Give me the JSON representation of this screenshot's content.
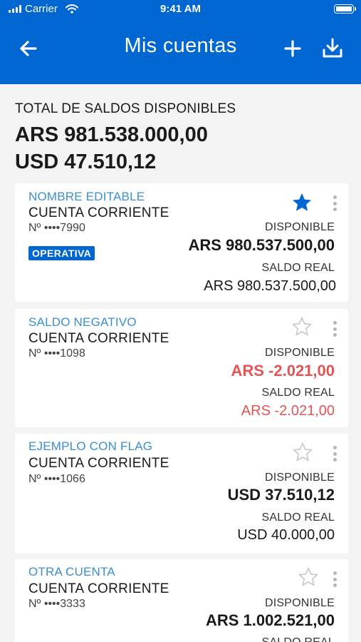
{
  "status_bar": {
    "carrier": "Carrier",
    "time": "9:41 AM"
  },
  "nav": {
    "title": "Mis cuentas",
    "back_icon": "arrow-left-icon",
    "add_icon": "plus-icon",
    "download_icon": "download-icon"
  },
  "summary": {
    "label": "TOTAL DE SALDOS DISPONIBLES",
    "amounts": [
      "ARS 981.538.000,00",
      "USD 47.510,12"
    ]
  },
  "accounts": [
    {
      "alias": "NOMBRE EDITABLE",
      "type": "CUENTA CORRIENTE",
      "number": "Nº ••••7990",
      "badge": "OPERATIVA",
      "favorite": true,
      "available_label": "DISPONIBLE",
      "available": "ARS 980.537.500,00",
      "real_label": "SALDO REAL",
      "real": "ARS 980.537.500,00",
      "negative": false
    },
    {
      "alias": "SALDO NEGATIVO",
      "type": "CUENTA CORRIENTE",
      "number": "Nº ••••1098",
      "badge": "",
      "favorite": false,
      "available_label": "DISPONIBLE",
      "available": "ARS -2.021,00",
      "real_label": "SALDO REAL",
      "real": "ARS -2.021,00",
      "negative": true
    },
    {
      "alias": "EJEMPLO CON FLAG",
      "type": "CUENTA CORRIENTE",
      "number": "Nº ••••1066",
      "badge": "",
      "favorite": false,
      "available_label": "DISPONIBLE",
      "available": "USD 37.510,12",
      "real_label": "SALDO REAL",
      "real": "USD 40.000,00",
      "negative": false
    },
    {
      "alias": "OTRA CUENTA",
      "type": "CUENTA CORRIENTE",
      "number": "Nº ••••3333",
      "badge": "",
      "favorite": false,
      "available_label": "DISPONIBLE",
      "available": "ARS 1.002.521,00",
      "real_label": "SALDO REAL",
      "real": "",
      "negative": false
    }
  ],
  "colors": {
    "primary": "#0067d2",
    "alias": "#3a8ed6",
    "negative": "#e45454",
    "background": "#f3f3f3"
  }
}
